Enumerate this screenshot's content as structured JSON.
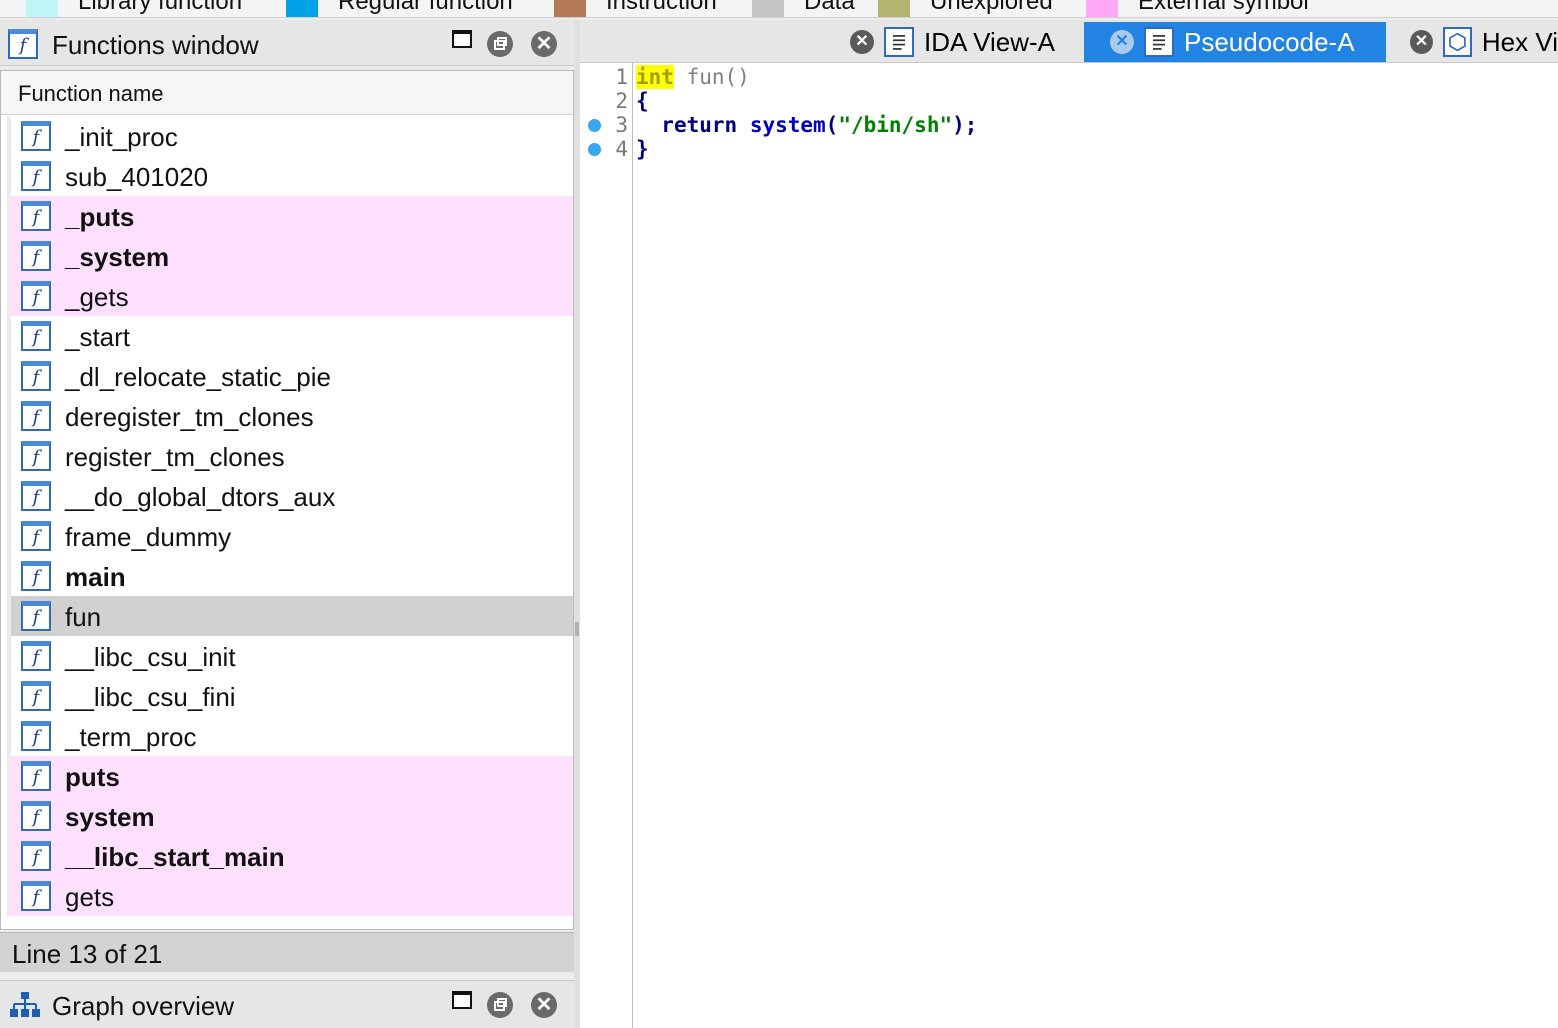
{
  "legend": [
    {
      "label": "Library function",
      "color": "#bff4f8"
    },
    {
      "label": "Regular function",
      "color": "#00a3e8"
    },
    {
      "label": "Instruction",
      "color": "#b47a56"
    },
    {
      "label": "Data",
      "color": "#c4c4c4"
    },
    {
      "label": "Unexplored",
      "color": "#b4b470"
    },
    {
      "label": "External symbol",
      "color": "#ffa8f8"
    }
  ],
  "functions_window": {
    "title": "Functions window",
    "column_header": "Function name",
    "rows": [
      {
        "name": "_init_proc",
        "style": "normal"
      },
      {
        "name": "sub_401020",
        "style": "normal"
      },
      {
        "name": "_puts",
        "style": "pink-bold"
      },
      {
        "name": "_system",
        "style": "pink-bold"
      },
      {
        "name": "_gets",
        "style": "pink"
      },
      {
        "name": "_start",
        "style": "normal"
      },
      {
        "name": "_dl_relocate_static_pie",
        "style": "normal"
      },
      {
        "name": "deregister_tm_clones",
        "style": "normal"
      },
      {
        "name": "register_tm_clones",
        "style": "normal"
      },
      {
        "name": "__do_global_dtors_aux",
        "style": "normal"
      },
      {
        "name": "frame_dummy",
        "style": "normal"
      },
      {
        "name": "main",
        "style": "bold"
      },
      {
        "name": "fun",
        "style": "selected"
      },
      {
        "name": "__libc_csu_init",
        "style": "normal"
      },
      {
        "name": "__libc_csu_fini",
        "style": "normal"
      },
      {
        "name": "_term_proc",
        "style": "normal"
      },
      {
        "name": "puts",
        "style": "pink-bold"
      },
      {
        "name": "system",
        "style": "pink-bold"
      },
      {
        "name": "__libc_start_main",
        "style": "pink-bold"
      },
      {
        "name": "gets",
        "style": "pink"
      }
    ],
    "status": "Line 13 of 21"
  },
  "graph_overview": {
    "title": "Graph overview"
  },
  "tabs": [
    {
      "label": "IDA View-A",
      "active": false
    },
    {
      "label": "Pseudocode-A",
      "active": true
    },
    {
      "label": "Hex Vi",
      "active": false
    }
  ],
  "pseudocode": {
    "line_numbers": [
      "1",
      "2",
      "3",
      "4"
    ],
    "line1": {
      "type": "int",
      "rest": " fun()"
    },
    "line2": {
      "text": "{"
    },
    "line3": {
      "kw": "return",
      "call": "system",
      "open": "(",
      "str": "\"/bin/sh\"",
      "close": ");"
    },
    "line4": {
      "text": "}"
    }
  }
}
